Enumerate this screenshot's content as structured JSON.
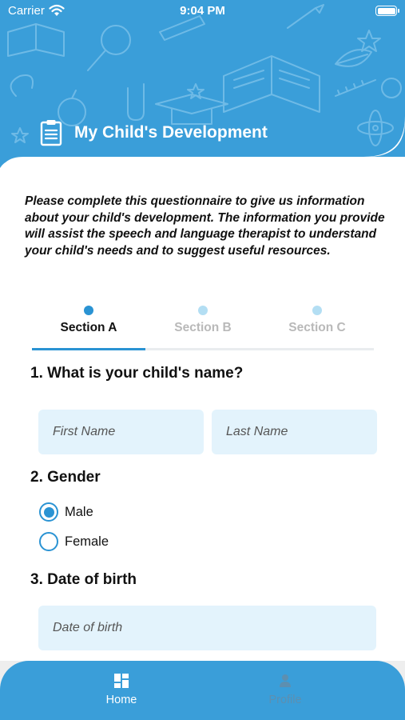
{
  "status_bar": {
    "carrier": "Carrier",
    "time": "9:04 PM"
  },
  "header": {
    "title": "My Child's Development",
    "icon": "clipboard-icon",
    "background_color": "#3a9ed9"
  },
  "intro_text": "Please complete this questionnaire to give us information about your child's development. The information you provide will assist the speech and language therapist to understand your child's needs and to suggest useful resources.",
  "tabs": [
    {
      "label": "Section A",
      "active": true
    },
    {
      "label": "Section B",
      "active": false
    },
    {
      "label": "Section C",
      "active": false
    }
  ],
  "questions": {
    "q1": {
      "label": "1. What is your child's name?",
      "first_name_placeholder": "First Name",
      "last_name_placeholder": "Last Name"
    },
    "q2": {
      "label": "2. Gender",
      "options": [
        {
          "label": "Male",
          "selected": true
        },
        {
          "label": "Female",
          "selected": false
        }
      ]
    },
    "q3": {
      "label": "3. Date of birth",
      "placeholder": "Date of birth"
    }
  },
  "bottom_nav": [
    {
      "label": "Home",
      "icon": "grid-icon",
      "active": true
    },
    {
      "label": "Profile",
      "icon": "person-icon",
      "active": false
    }
  ],
  "colors": {
    "accent": "#2a93d3",
    "field_background": "#e3f3fc",
    "inactive_tab": "#b9b9b9"
  }
}
